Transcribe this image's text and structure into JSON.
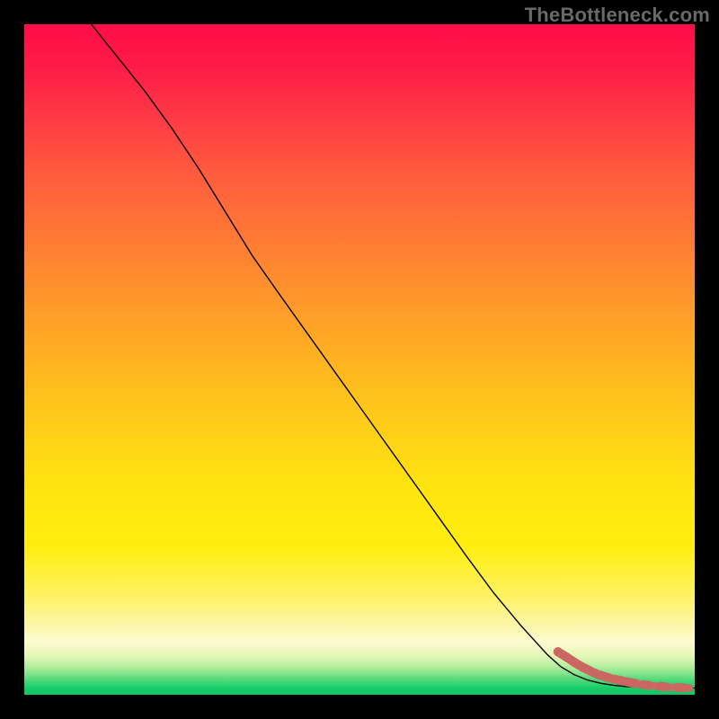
{
  "watermark": "TheBottleneck.com",
  "chart_data": {
    "type": "line",
    "title": "",
    "xlabel": "",
    "ylabel": "",
    "xlim": [
      0,
      100
    ],
    "ylim": [
      0,
      100
    ],
    "grid": false,
    "series": [
      {
        "name": "curve",
        "color": "#000000",
        "x": [
          10,
          14,
          18,
          22,
          26,
          30,
          34,
          38,
          42,
          46,
          50,
          54,
          58,
          62,
          66,
          70,
          74,
          78,
          80,
          82,
          84,
          86,
          88,
          90,
          92,
          94,
          96,
          98,
          100
        ],
        "y": [
          100,
          95,
          90,
          84.5,
          78.5,
          72,
          65.5,
          59.8,
          54.2,
          48.6,
          43.0,
          37.4,
          31.8,
          26.2,
          20.6,
          15.2,
          10.4,
          6.0,
          4.2,
          3.0,
          2.2,
          1.7,
          1.4,
          1.2,
          1.1,
          1.05,
          1.0,
          1.0,
          1.0
        ]
      }
    ],
    "bottom_markers": {
      "color": "#cc6a66",
      "points_x": [
        79.6,
        80.9,
        82.1,
        83.3,
        84.9,
        85.6,
        86.3,
        87.6,
        89.5,
        91.5,
        94.0,
        96.6,
        99.2
      ],
      "points_y": [
        6.4,
        5.6,
        4.8,
        4.1,
        3.3,
        3.0,
        2.8,
        2.4,
        2.0,
        1.6,
        1.3,
        1.1,
        1.0
      ]
    }
  }
}
